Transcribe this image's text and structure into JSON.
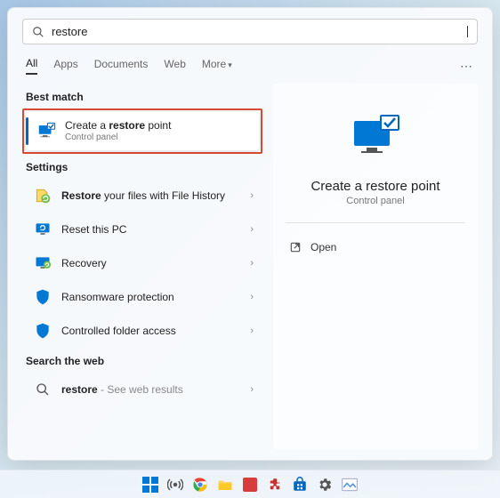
{
  "search": {
    "query": "restore"
  },
  "tabs": {
    "all": "All",
    "apps": "Apps",
    "documents": "Documents",
    "web": "Web",
    "more": "More"
  },
  "sections": {
    "best_match": "Best match",
    "settings": "Settings",
    "search_web": "Search the web"
  },
  "best_match": {
    "title_pre": "Create a ",
    "title_bold": "restore",
    "title_post": " point",
    "sub": "Control panel"
  },
  "settings_items": [
    {
      "bold": "Restore",
      "rest": " your files with File History"
    },
    {
      "bold": "",
      "rest": "Reset this PC"
    },
    {
      "bold": "",
      "rest": "Recovery"
    },
    {
      "bold": "",
      "rest": "Ransomware protection"
    },
    {
      "bold": "",
      "rest": "Controlled folder access"
    }
  ],
  "web_item": {
    "term": "restore",
    "hint": " - See web results"
  },
  "preview": {
    "title": "Create a restore point",
    "sub": "Control panel",
    "open": "Open"
  }
}
